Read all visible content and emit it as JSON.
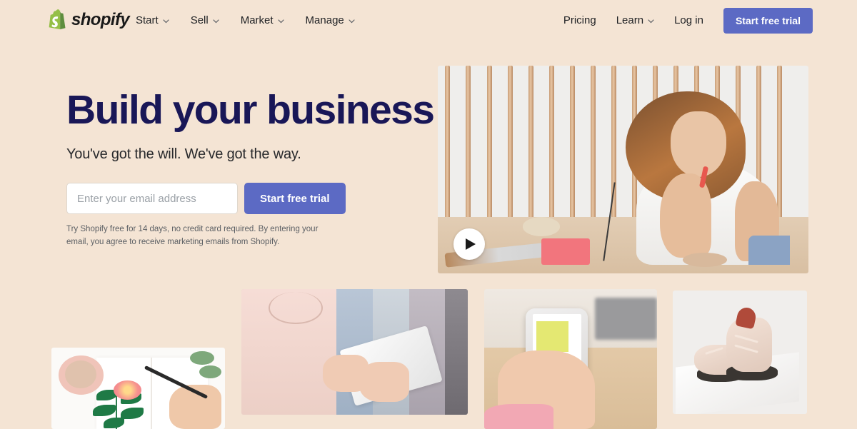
{
  "brand": {
    "name": "shopify",
    "logo_icon": "shopify-bag-icon",
    "logo_color": "#95bf47"
  },
  "nav": {
    "primary": [
      {
        "label": "Start",
        "has_dropdown": true
      },
      {
        "label": "Sell",
        "has_dropdown": true
      },
      {
        "label": "Market",
        "has_dropdown": true
      },
      {
        "label": "Manage",
        "has_dropdown": true
      }
    ],
    "secondary": [
      {
        "label": "Pricing",
        "has_dropdown": false
      },
      {
        "label": "Learn",
        "has_dropdown": true
      },
      {
        "label": "Log in",
        "has_dropdown": false
      }
    ],
    "cta_label": "Start free trial",
    "cta_color": "#5c6ac4",
    "chevron_icon": "chevron-down-icon"
  },
  "hero": {
    "headline": "Build your business",
    "headline_color": "#191757",
    "subheadline": "You've got the will. We've got the way.",
    "email_placeholder": "Enter your email address",
    "email_value": "",
    "cta_label": "Start free trial",
    "fineprint": "Try Shopify free for 14 days, no credit card required. By entering your email, you agree to receive marketing emails from Shopify.",
    "video": {
      "alt": "Woman crafting jewelry at a workbench in front of a slatted wall",
      "play_icon": "play-icon"
    }
  },
  "gallery": [
    {
      "name": "sketchbook",
      "alt": "Hands painting a pink flower in a sketchbook beside a ceramic bowl"
    },
    {
      "name": "tablet",
      "alt": "Person in pink top using a tablet in front of a clothing rack"
    },
    {
      "name": "phone",
      "alt": "Hand holding a smartphone showing an online store collection page"
    },
    {
      "name": "shoes",
      "alt": "Pair of blush leather oxford shoes on a white pedestal"
    }
  ],
  "theme": {
    "background": "#f4e4d4",
    "accent": "#5c6ac4",
    "navy": "#191757"
  }
}
